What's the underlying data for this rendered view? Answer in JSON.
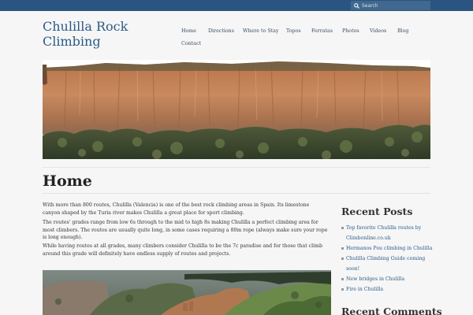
{
  "topbar": {
    "search": {
      "placeholder": "Search",
      "value": ""
    }
  },
  "header": {
    "site_title": "Chulilla Rock Climbing"
  },
  "nav": {
    "items": [
      "Home",
      "Directions",
      "Where to Stay",
      "Topos",
      "Ferratas",
      "Photos",
      "Videos",
      "Blog",
      "Contact"
    ]
  },
  "hero": {
    "image": "limestone-cliff-panorama"
  },
  "main": {
    "title": "Home",
    "paragraphs": [
      "With more than 800 routes, Chulilla (Valencia) is one of the best rock climbing areas in Spain. Its limestone canyon shaped by the Turia river makes Chulilla a great place for sport climbing.",
      "The routes' grades range from low 6s through to the mid to high 8s making Chulilla a perfect climbing area for most climbers. The routes are usually quite long, in some cases requiring a 80m rope (always make sure your rope is long enough).",
      "While having routes at all grades, many climbers consider Chulilla to be the 7c paradise and for those that climb around this grade will definitely have endless supply of routes and projects."
    ],
    "photo": "canyon-aerial-photo"
  },
  "sidebar": {
    "recent_posts_title": "Recent Posts",
    "posts": [
      "Top favorite Chulilla routes by Climbonline.co.uk",
      "Hermanos Pou climbing in Chulilla",
      "Chulilla Climbing Guide coming soon!",
      "New bridges in Chulilla",
      "Fire in Chulilla"
    ],
    "recent_comments_title": "Recent Comments"
  },
  "colors": {
    "topbar": "#2a5580",
    "link": "#2b5b86",
    "background": "#f6f6f6"
  }
}
